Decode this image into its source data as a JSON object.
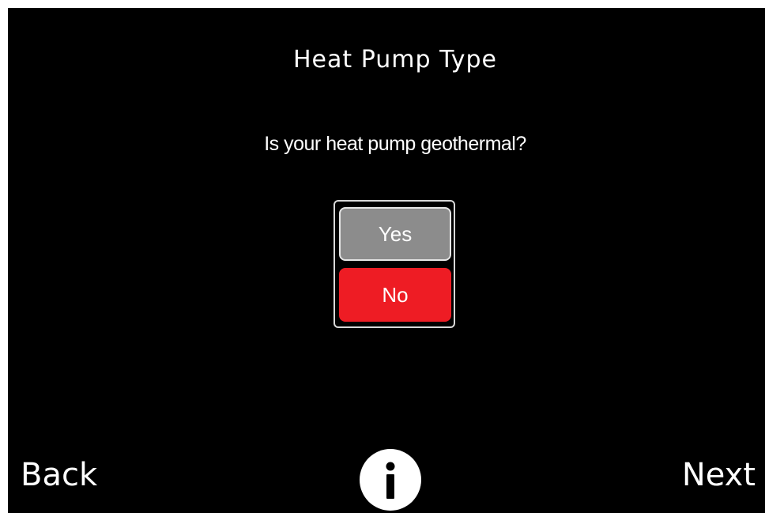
{
  "header": {
    "title": "Heat Pump Type"
  },
  "prompt": {
    "question": "Is your heat pump geothermal?"
  },
  "options": {
    "selected": "No",
    "items": [
      {
        "label": "Yes",
        "state": "unselected",
        "color": "#8c8c8c"
      },
      {
        "label": "No",
        "state": "selected",
        "color": "#ee1c24"
      }
    ]
  },
  "footer": {
    "back_label": "Back",
    "next_label": "Next",
    "info_icon": "info-icon"
  },
  "colors": {
    "background": "#000000",
    "text": "#ffffff",
    "selected": "#ee1c24",
    "unselected": "#8c8c8c"
  }
}
